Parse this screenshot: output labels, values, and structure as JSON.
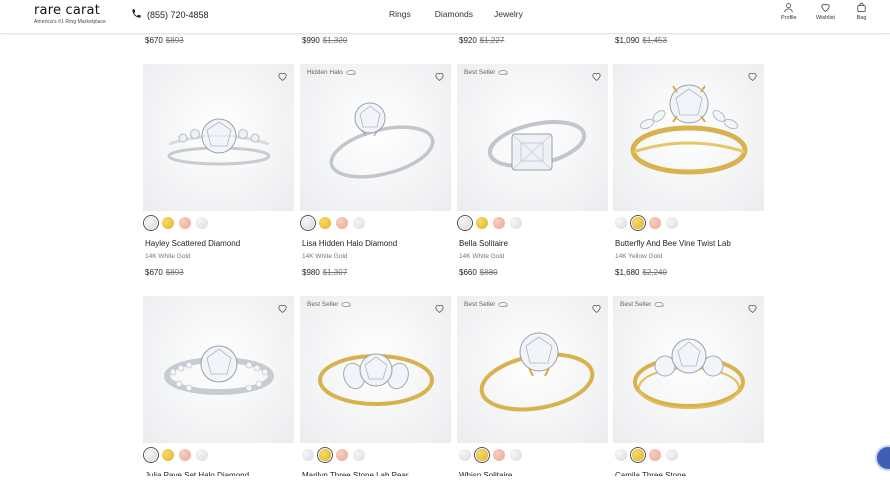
{
  "header": {
    "logo_text": "rare carat",
    "logo_tagline": "America's #1 Ring Marketplace",
    "phone": "(855) 720-4858",
    "nav": [
      "Rings",
      "Diamonds",
      "Jewelry"
    ],
    "utilities": [
      {
        "label": "Profile",
        "icon": "person-icon"
      },
      {
        "label": "Wishlist",
        "icon": "heart-icon"
      },
      {
        "label": "Bag",
        "icon": "bag-icon"
      }
    ]
  },
  "top_row_prices": [
    {
      "price": "$670",
      "old": "$893"
    },
    {
      "price": "$990",
      "old": "$1,320"
    },
    {
      "price": "$920",
      "old": "$1,227"
    },
    {
      "price": "$1,090",
      "old": "$1,453"
    }
  ],
  "products_row1": [
    {
      "badge": "",
      "name": "Hayley Scattered Diamond",
      "metal": "14K White Gold",
      "price": "$670",
      "old_price": "$893",
      "metal_color": "white",
      "selected": 0
    },
    {
      "badge": "Hidden Halo",
      "name": "Lisa Hidden Halo Diamond",
      "metal": "14K White Gold",
      "price": "$980",
      "old_price": "$1,307",
      "metal_color": "white",
      "selected": 0
    },
    {
      "badge": "Best Seller",
      "name": "Bella Solitaire",
      "metal": "14K White Gold",
      "price": "$660",
      "old_price": "$880",
      "metal_color": "white",
      "selected": 0
    },
    {
      "badge": "",
      "name": "Butterfly And Bee Vine Twist Lab",
      "metal": "14K Yellow Gold",
      "price": "$1,680",
      "old_price": "$2,240",
      "metal_color": "yellow",
      "selected": 1
    }
  ],
  "products_row2": [
    {
      "badge": "",
      "name": "Julia Pave Set Halo Diamond",
      "metal_color": "white",
      "selected": 0
    },
    {
      "badge": "Best Seller",
      "name": "Marilyn Three Stone Lab Pear",
      "metal_color": "yellow",
      "selected": 1
    },
    {
      "badge": "Best Seller",
      "name": "Whisp Solitaire",
      "metal_color": "yellow",
      "selected": 1
    },
    {
      "badge": "Best Seller",
      "name": "Camila Three Stone",
      "metal_color": "yellow",
      "selected": 1
    }
  ],
  "colors": {
    "white_metal": "#cfd2d6",
    "yellow_metal": "#e8c15a",
    "badge_text": "#666666",
    "strike_price": "#777777"
  }
}
